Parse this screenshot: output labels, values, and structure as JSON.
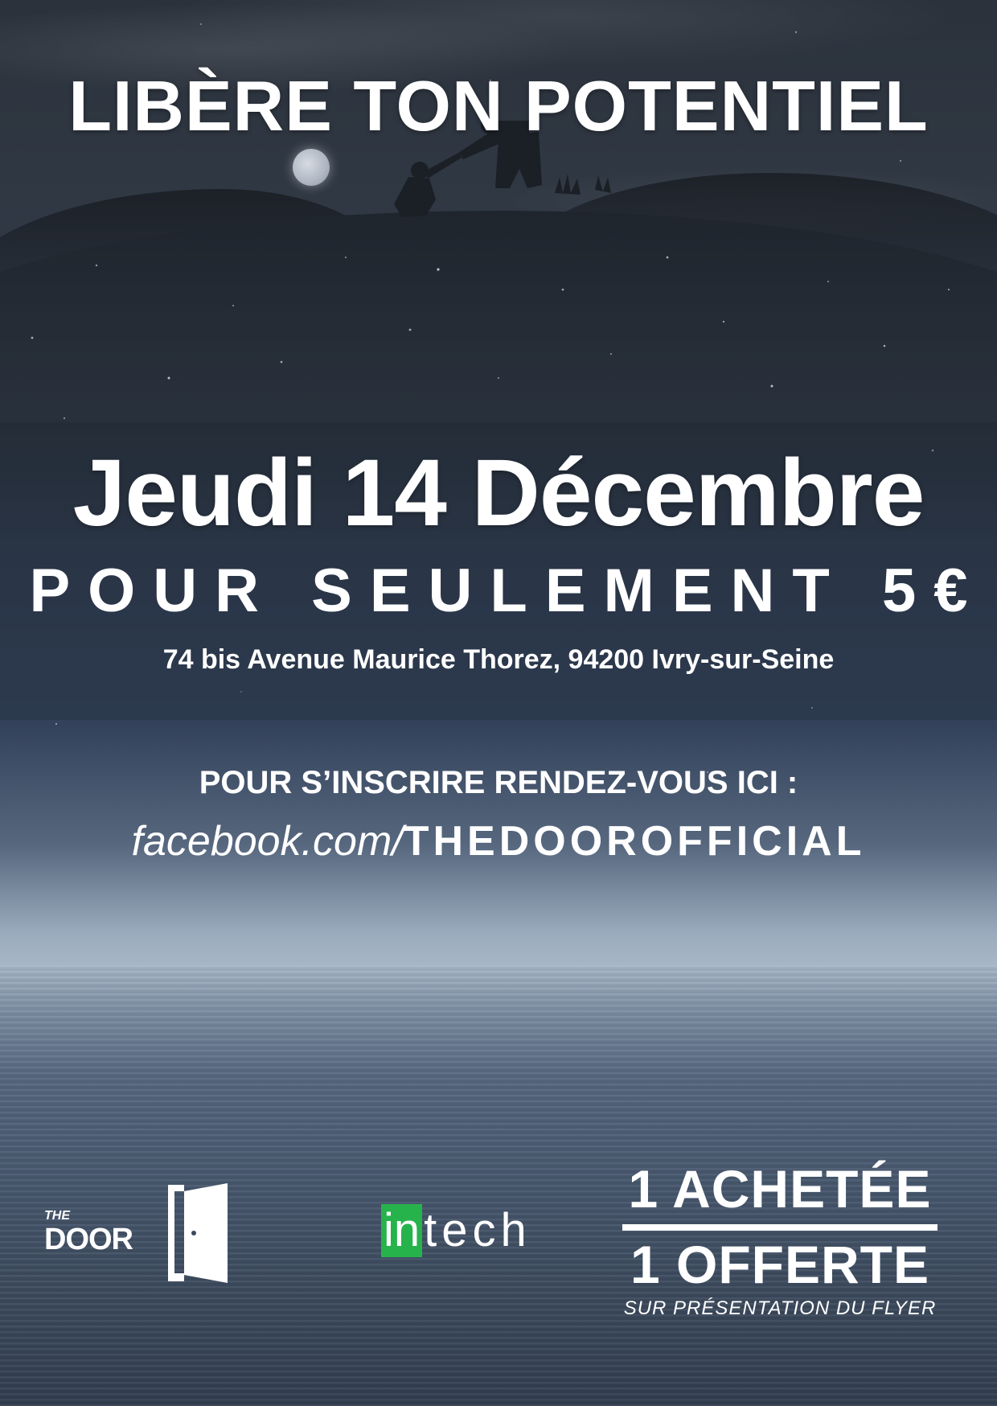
{
  "headline": "LIBÈRE TON POTENTIEL",
  "event": {
    "date": "Jeudi 14 Décembre",
    "price": "POUR SEULEMENT 5€",
    "address": "74 bis Avenue Maurice Thorez, 94200 Ivry-sur-Seine"
  },
  "signup": {
    "label": "POUR S’INSCRIRE RENDEZ-VOUS ICI :",
    "link_prefix": "facebook.com/",
    "link_handle": "THEDOOROFFICIAL"
  },
  "logos": {
    "door_small": "THE",
    "door_word": "DOOR",
    "door_icon": "door-icon",
    "intech_in": "in",
    "intech_tech": "tech",
    "intech_accent": "#27b34b"
  },
  "offer": {
    "line1": "1 ACHETÉE",
    "line2": "1 OFFERTE",
    "note": "SUR PRÉSENTATION DU FLYER"
  },
  "colors": {
    "text": "#ffffff",
    "sky_dark": "#2b323c",
    "horizon_light": "#a7b6c6"
  }
}
